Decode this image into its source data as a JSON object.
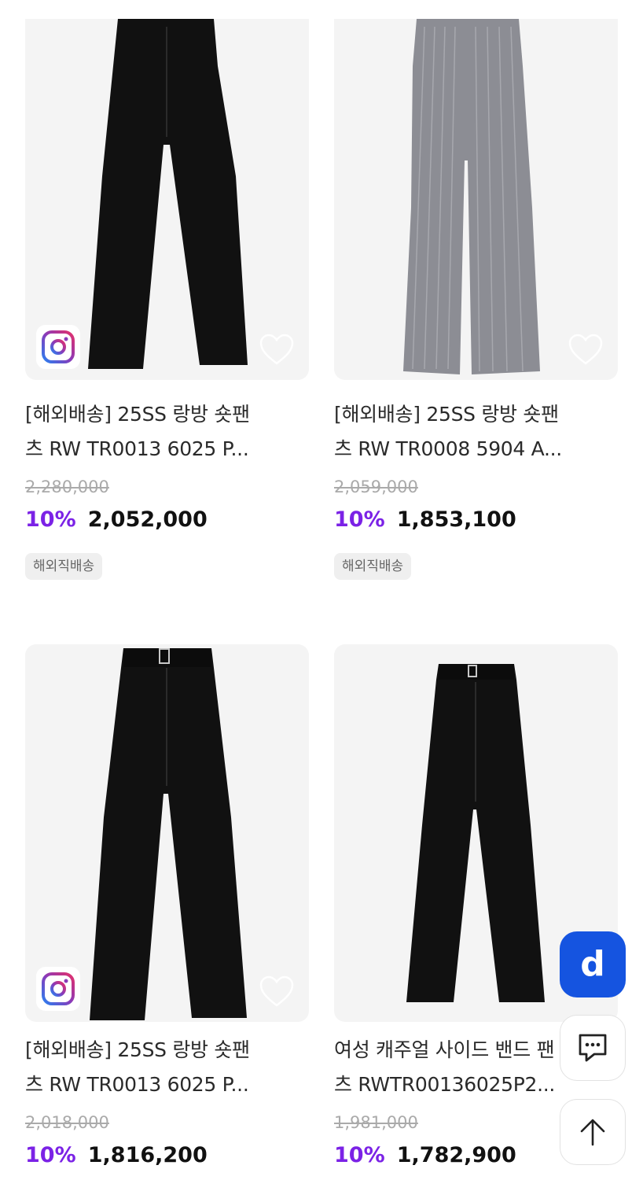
{
  "products": [
    {
      "title_line1": "[해외배송] 25SS 랑방 숏팬",
      "title_line2": "츠 RW TR0013 6025 P...",
      "original_price": "2,280,000",
      "discount": "10%",
      "price": "2,052,000",
      "tag": "해외직배송",
      "pants_color": "#111111",
      "has_instagram": true
    },
    {
      "title_line1": "[해외배송] 25SS 랑방 숏팬",
      "title_line2": "츠 RW TR0008 5904 A...",
      "original_price": "2,059,000",
      "discount": "10%",
      "price": "1,853,100",
      "tag": "해외직배송",
      "pants_color": "#8c8d94",
      "has_instagram": false
    },
    {
      "title_line1": "[해외배송] 25SS 랑방 숏팬",
      "title_line2": "츠 RW TR0013 6025 P...",
      "original_price": "2,018,000",
      "discount": "10%",
      "price": "1,816,200",
      "pants_color": "#111111",
      "has_instagram": true
    },
    {
      "title_line1": "여성 캐주얼 사이드 밴드 팬",
      "title_line2": "츠 RWTR00136025P2...",
      "original_price": "1,981,000",
      "discount": "10%",
      "price": "1,782,900",
      "pants_color": "#111111",
      "has_instagram": false
    }
  ],
  "floating": {
    "app_button_label": "d",
    "chat_icon": "chat-icon",
    "top_icon": "arrow-up-icon"
  },
  "colors": {
    "discount": "#7b22e6",
    "app_button": "#1554e0"
  }
}
